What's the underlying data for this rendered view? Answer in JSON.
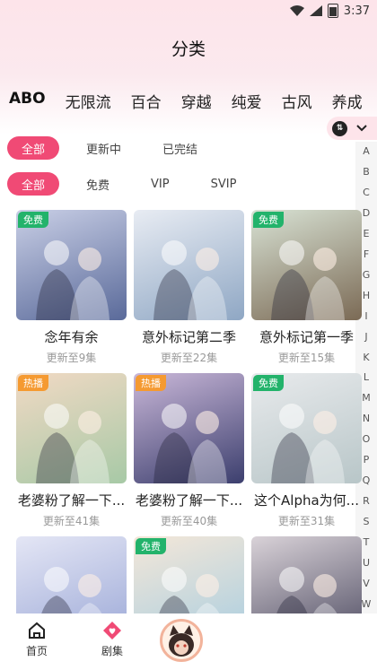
{
  "status_bar": {
    "time": "3:37"
  },
  "header": {
    "title": "分类"
  },
  "tabs": [
    {
      "label": "ABO",
      "active": true
    },
    {
      "label": "无限流"
    },
    {
      "label": "百合"
    },
    {
      "label": "穿越"
    },
    {
      "label": "纯爱"
    },
    {
      "label": "古风"
    },
    {
      "label": "养成"
    }
  ],
  "filters": {
    "status": [
      {
        "label": "全部",
        "active": true
      },
      {
        "label": "更新中"
      },
      {
        "label": "已完结"
      }
    ],
    "pay": [
      {
        "label": "全部",
        "active": true
      },
      {
        "label": "免费"
      },
      {
        "label": "VIP"
      },
      {
        "label": "SVIP"
      }
    ]
  },
  "alpha_index": [
    "A",
    "B",
    "C",
    "D",
    "E",
    "F",
    "G",
    "H",
    "I",
    "J",
    "K",
    "L",
    "M",
    "N",
    "O",
    "P",
    "Q",
    "R",
    "S",
    "T",
    "U",
    "V",
    "W"
  ],
  "cards": [
    {
      "title": "念年有余",
      "sub": "更新至9集",
      "badge": "免费",
      "badge_type": "free",
      "colors": [
        "#5a6a9a",
        "#c9cfe6"
      ]
    },
    {
      "title": "意外标记第二季",
      "sub": "更新至22集",
      "badge": "",
      "badge_type": "",
      "colors": [
        "#8fa7c4",
        "#e8ecf3"
      ]
    },
    {
      "title": "意外标记第一季",
      "sub": "更新至15集",
      "badge": "免费",
      "badge_type": "free",
      "colors": [
        "#7b6a55",
        "#d8e2d4"
      ]
    },
    {
      "title": "老婆粉了解一下...",
      "sub": "更新至41集",
      "badge": "热播",
      "badge_type": "hot",
      "colors": [
        "#a7c9a6",
        "#f1d9c4"
      ]
    },
    {
      "title": "老婆粉了解一下...",
      "sub": "更新至40集",
      "badge": "热播",
      "badge_type": "hot",
      "colors": [
        "#3c3f6e",
        "#c9b7d8"
      ]
    },
    {
      "title": "这个Alpha为何...",
      "sub": "更新至31集",
      "badge": "免费",
      "badge_type": "free",
      "colors": [
        "#b8c6c8",
        "#e8eaec"
      ]
    },
    {
      "title": "",
      "sub": "",
      "badge": "",
      "badge_type": "",
      "colors": [
        "#9aa7d6",
        "#e4e6f5"
      ]
    },
    {
      "title": "",
      "sub": "",
      "badge": "免费",
      "badge_type": "free",
      "colors": [
        "#a8cde0",
        "#f4e7d8"
      ]
    },
    {
      "title": "",
      "sub": "",
      "badge": "",
      "badge_type": "",
      "colors": [
        "#4c4a60",
        "#d9d2d8"
      ]
    }
  ],
  "bottom_nav": {
    "home_label": "首页",
    "drama_label": "剧集"
  },
  "colors": {
    "accent": "#f04a75",
    "free": "#23b36b",
    "hot": "#f59a31"
  }
}
